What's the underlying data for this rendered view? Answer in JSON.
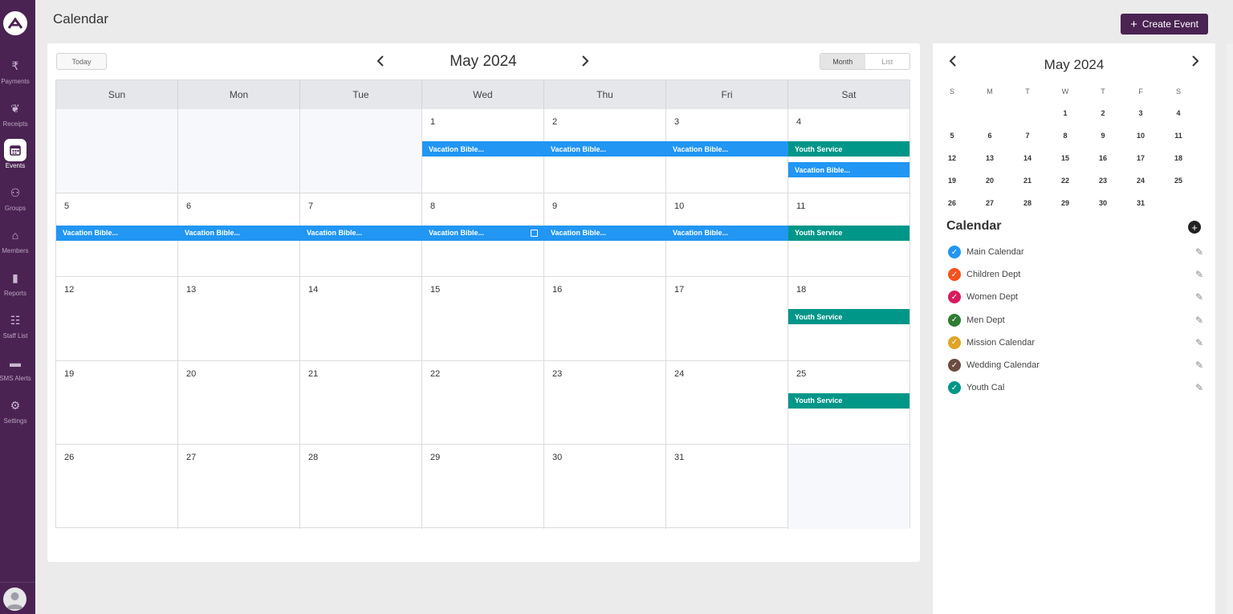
{
  "app": {
    "page_title": "Calendar",
    "create_button": "Create Event"
  },
  "sidebar": {
    "items": [
      {
        "label": "Payments",
        "icon": "rupee-icon",
        "glyph": "₹"
      },
      {
        "label": "Receipts",
        "icon": "leaf-icon",
        "glyph": "❦"
      },
      {
        "label": "Events",
        "icon": "calendar-icon",
        "glyph": "▦",
        "active": true
      },
      {
        "label": "Groups",
        "icon": "groups-icon",
        "glyph": "⚇"
      },
      {
        "label": "Members",
        "icon": "home-icon",
        "glyph": "⌂"
      },
      {
        "label": "Reports",
        "icon": "bar-chart-icon",
        "glyph": "▮"
      },
      {
        "label": "Staff List",
        "icon": "staff-icon",
        "glyph": "☷"
      },
      {
        "label": "SMS Alerts",
        "icon": "chat-icon",
        "glyph": "▬"
      },
      {
        "label": "Settings",
        "icon": "gear-icon",
        "glyph": "⚙"
      }
    ]
  },
  "toolbar": {
    "today_label": "Today",
    "month_title": "May 2024",
    "view_month": "Month",
    "view_list": "List"
  },
  "weekdays": [
    "Sun",
    "Mon",
    "Tue",
    "Wed",
    "Thu",
    "Fri",
    "Sat"
  ],
  "weeks": [
    [
      null,
      null,
      null,
      "1",
      "2",
      "3",
      "4"
    ],
    [
      "5",
      "6",
      "7",
      "8",
      "9",
      "10",
      "11"
    ],
    [
      "12",
      "13",
      "14",
      "15",
      "16",
      "17",
      "18"
    ],
    [
      "19",
      "20",
      "21",
      "22",
      "23",
      "24",
      "25"
    ],
    [
      "26",
      "27",
      "28",
      "29",
      "30",
      "31",
      null
    ]
  ],
  "events": {
    "vacation": "Vacation Bible...",
    "youth": "Youth Service"
  },
  "mini_calendar": {
    "title": "May 2024",
    "weekday_initials": [
      "S",
      "M",
      "T",
      "W",
      "T",
      "F",
      "S"
    ],
    "weeks": [
      [
        "",
        "",
        "",
        "1",
        "2",
        "3",
        "4"
      ],
      [
        "5",
        "6",
        "7",
        "8",
        "9",
        "10",
        "11"
      ],
      [
        "12",
        "13",
        "14",
        "15",
        "16",
        "17",
        "18"
      ],
      [
        "19",
        "20",
        "21",
        "22",
        "23",
        "24",
        "25"
      ],
      [
        "26",
        "27",
        "28",
        "29",
        "30",
        "31",
        ""
      ]
    ]
  },
  "calendars": {
    "heading": "Calendar",
    "items": [
      {
        "name": "Main Calendar",
        "color": "#2196f3"
      },
      {
        "name": "Children Dept",
        "color": "#f4511e"
      },
      {
        "name": "Women Dept",
        "color": "#d81b60"
      },
      {
        "name": "Men Dept",
        "color": "#2e7d32"
      },
      {
        "name": "Mission Calendar",
        "color": "#e0a526"
      },
      {
        "name": "Wedding Calendar",
        "color": "#6d4c41"
      },
      {
        "name": "Youth Cal",
        "color": "#009688"
      }
    ]
  },
  "colors": {
    "brand": "#4a2352",
    "vacation_event": "#2196f3",
    "youth_event": "#009688"
  }
}
